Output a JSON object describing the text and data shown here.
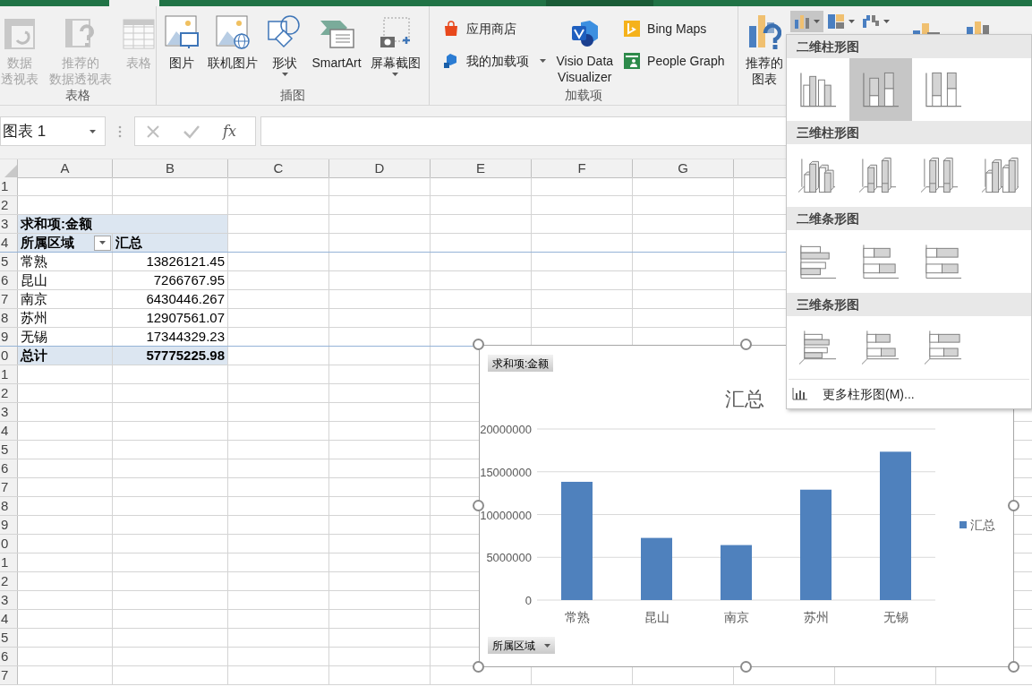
{
  "ribbon": {
    "groups": [
      {
        "label": "表格",
        "buttons": [
          {
            "lines": [
              "数据",
              "透视表"
            ],
            "kind": "pivot",
            "disabled": true,
            "menu": false
          },
          {
            "lines": [
              "推荐的",
              "数据透视表"
            ],
            "kind": "recommended-pivot",
            "disabled": true,
            "menu": false
          },
          {
            "label": "表格",
            "kind": "table",
            "disabled": true,
            "menu": false
          }
        ]
      },
      {
        "label": "插图",
        "buttons": [
          {
            "label": "图片",
            "kind": "picture",
            "disabled": false,
            "menu": false
          },
          {
            "label": "联机图片",
            "kind": "online-picture",
            "disabled": false,
            "menu": false
          },
          {
            "label": "形状",
            "kind": "shapes",
            "disabled": false,
            "menu": true
          },
          {
            "label": "SmartArt",
            "kind": "smartart",
            "disabled": false,
            "menu": false
          },
          {
            "label": "屏幕截图",
            "kind": "screenshot",
            "disabled": false,
            "menu": true
          }
        ]
      },
      {
        "label": "加载项",
        "buttons": [
          {
            "label": "应用商店",
            "kind": "store",
            "disabled": false,
            "menu": false
          },
          {
            "label": "我的加载项",
            "kind": "my-addins",
            "disabled": false,
            "menu": true
          },
          {
            "label": "Visio Data\nVisualizer",
            "kind": "visio",
            "disabled": false,
            "menu": false
          },
          {
            "label": "Bing Maps",
            "kind": "bing",
            "disabled": false,
            "menu": false
          },
          {
            "label": "People Graph",
            "kind": "people",
            "disabled": false,
            "menu": false
          }
        ]
      },
      {
        "buttons": [
          {
            "lines": [
              "推荐的",
              "图表"
            ],
            "kind": "recommended-chart",
            "disabled": false,
            "menu": false
          }
        ],
        "small": [
          {
            "kind": "column",
            "expanded": true
          },
          {
            "kind": "hierarchy",
            "expanded": false
          },
          {
            "kind": "waterfall",
            "expanded": false
          }
        ]
      }
    ]
  },
  "formula_bar": {
    "name_box": "图表 1",
    "fx": "fx"
  },
  "sheet": {
    "columns": [
      "A",
      "B",
      "C",
      "D",
      "E",
      "F",
      "G"
    ],
    "rows": [
      {
        "header": "1"
      },
      {
        "header": "2"
      },
      {
        "header": "3",
        "kind": "pivot-title",
        "cells": [
          "求和项:金额"
        ]
      },
      {
        "header": "4",
        "kind": "pivot-header",
        "cells": [
          "所属区域",
          "汇总"
        ]
      },
      {
        "header": "5",
        "kind": "data",
        "cells": [
          "常熟",
          "13826121.45"
        ]
      },
      {
        "header": "6",
        "kind": "data",
        "cells": [
          "昆山",
          "7266767.95"
        ]
      },
      {
        "header": "7",
        "kind": "data",
        "cells": [
          "南京",
          "6430446.267"
        ]
      },
      {
        "header": "8",
        "kind": "data",
        "cells": [
          "苏州",
          "12907561.07"
        ]
      },
      {
        "header": "9",
        "kind": "data",
        "cells": [
          "无锡",
          "17344329.23"
        ]
      },
      {
        "header": "0",
        "kind": "total",
        "cells": [
          "总计",
          "57775225.98"
        ]
      },
      {
        "header": "1"
      },
      {
        "header": "2"
      },
      {
        "header": "3"
      },
      {
        "header": "4"
      },
      {
        "header": "5"
      },
      {
        "header": "6"
      },
      {
        "header": "7"
      },
      {
        "header": "8"
      },
      {
        "header": "9"
      },
      {
        "header": "0"
      },
      {
        "header": "1"
      },
      {
        "header": "2"
      },
      {
        "header": "3"
      },
      {
        "header": "4"
      },
      {
        "header": "5"
      },
      {
        "header": "6"
      },
      {
        "header": "7"
      }
    ]
  },
  "chart": {
    "value_field": "求和项:金额",
    "axis_field": "所属区域",
    "chart_data": {
      "type": "bar",
      "title": "汇总",
      "categories": [
        "常熟",
        "昆山",
        "南京",
        "苏州",
        "无锡"
      ],
      "series": [
        {
          "name": "汇总",
          "color": "#4f81bd",
          "values": [
            13826121.45,
            7266767.95,
            6430446.267,
            12907561.07,
            17344329.23
          ]
        }
      ],
      "grid": true,
      "ylim": [
        0,
        20000000
      ],
      "yticks": [
        0,
        5000000,
        10000000,
        15000000,
        20000000
      ]
    }
  },
  "chart_menu": {
    "sections": [
      {
        "title": "二维柱形图",
        "items": [
          {
            "kind": "clustered",
            "selected": false
          },
          {
            "kind": "stacked",
            "selected": true
          },
          {
            "kind": "stacked100",
            "selected": false
          }
        ]
      },
      {
        "title": "三维柱形图",
        "items": [
          {
            "kind": "clustered3d",
            "selected": false
          },
          {
            "kind": "stacked3d",
            "selected": false
          },
          {
            "kind": "full3d",
            "selected": false
          },
          {
            "kind": "column3d",
            "selected": false
          }
        ]
      },
      {
        "title": "二维条形图",
        "items": [
          {
            "kind": "bar-clustered",
            "selected": false
          },
          {
            "kind": "bar-stacked",
            "selected": false
          },
          {
            "kind": "bar-stacked100",
            "selected": false
          }
        ]
      },
      {
        "title": "三维条形图",
        "items": [
          {
            "kind": "barclustered3d",
            "selected": false
          },
          {
            "kind": "barstacked3d",
            "selected": false
          },
          {
            "kind": "barfull3d",
            "selected": false
          }
        ]
      }
    ],
    "more": "更多柱形图(M)..."
  }
}
